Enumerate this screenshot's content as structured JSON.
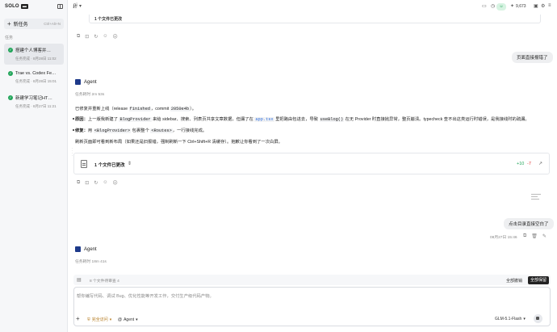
{
  "sidebar": {
    "logo_text": "SOLO",
    "logo_box": "",
    "new_task_label": "新任务",
    "new_task_shortcut": "Ctrl+Alt+N",
    "section_label": "任务",
    "tasks": [
      {
        "title": "搭建个人博客并…",
        "sub": "任务完成 · 8月28日 11:02"
      },
      {
        "title": "Trae vs. Codex Fe…",
        "sub": "任务完成 · 8月28日 15:01"
      },
      {
        "title": "新建学习笔记HT…",
        "sub": "任务完成 · 8月27日 11:21"
      }
    ]
  },
  "topbar": {
    "title": "pi",
    "user_badge": "☺",
    "credits": "9,673"
  },
  "conversation": {
    "card_stub_title": "1 个文件已更改",
    "user_msg_1": "页面直接报错了",
    "agent_name": "Agent",
    "meta_1": "任务耗时 2m 53s",
    "summary_line": {
      "pre": "已修复并重新上线（release ",
      "code1": "finished",
      "mid": "，commit ",
      "code2": "2050e4b",
      "post": "）。"
    },
    "bullet_1": {
      "label": "原因：",
      "t1": "上一版我新建了 ",
      "code1": "BlogProvider",
      "t2": " 来给 sidebar、搜索、列表页共享文章数据，但漏了在 ",
      "code2": "app.tsx",
      "t3": " 里把路由包进去，导致 ",
      "code3": "useBlog()",
      "t4": " 在无 Provider 时直接抛异常，整页崩溃。typecheck 查不出这类运行时错误，是我接线时的疏漏。"
    },
    "bullet_2": {
      "label": "修复：",
      "t1": "用 ",
      "code1": "<BlogProvider>",
      "t2": " 包裹整个 ",
      "code2": "<Routes>",
      "t3": "，一行接线完成。"
    },
    "closing_line": "刷新页面即可看到新布局（如果还是旧报错，强制刷新一下 Ctrl+Shift+R 清缓存）。抱歉让你看到了一次白屏。",
    "file_card": {
      "title": "1 个文件已更改",
      "additions": "+10",
      "deletions": "-7"
    },
    "user_msg_2": "点击目录直接空白了",
    "user_msg_2_time": "08月27日 15:46",
    "agent_name_2": "Agent",
    "meta_2": "任务耗时 18m 41s"
  },
  "composer": {
    "queue_text": "8 个文件待审查 4",
    "cancel_label": "全部撤销",
    "keep_label": "全部保留",
    "placeholder": "帮你编写代码、调试 Bug、优化性能等开发工作，交付生产级代码产物。",
    "mode_label": "完全访问",
    "agent_label": "Agent",
    "model_label": "GLM-5.1-Flash"
  },
  "colors": {
    "accent_green": "#22a55a",
    "code_blue": "#2f6fdd",
    "primary_dark": "#222222"
  }
}
